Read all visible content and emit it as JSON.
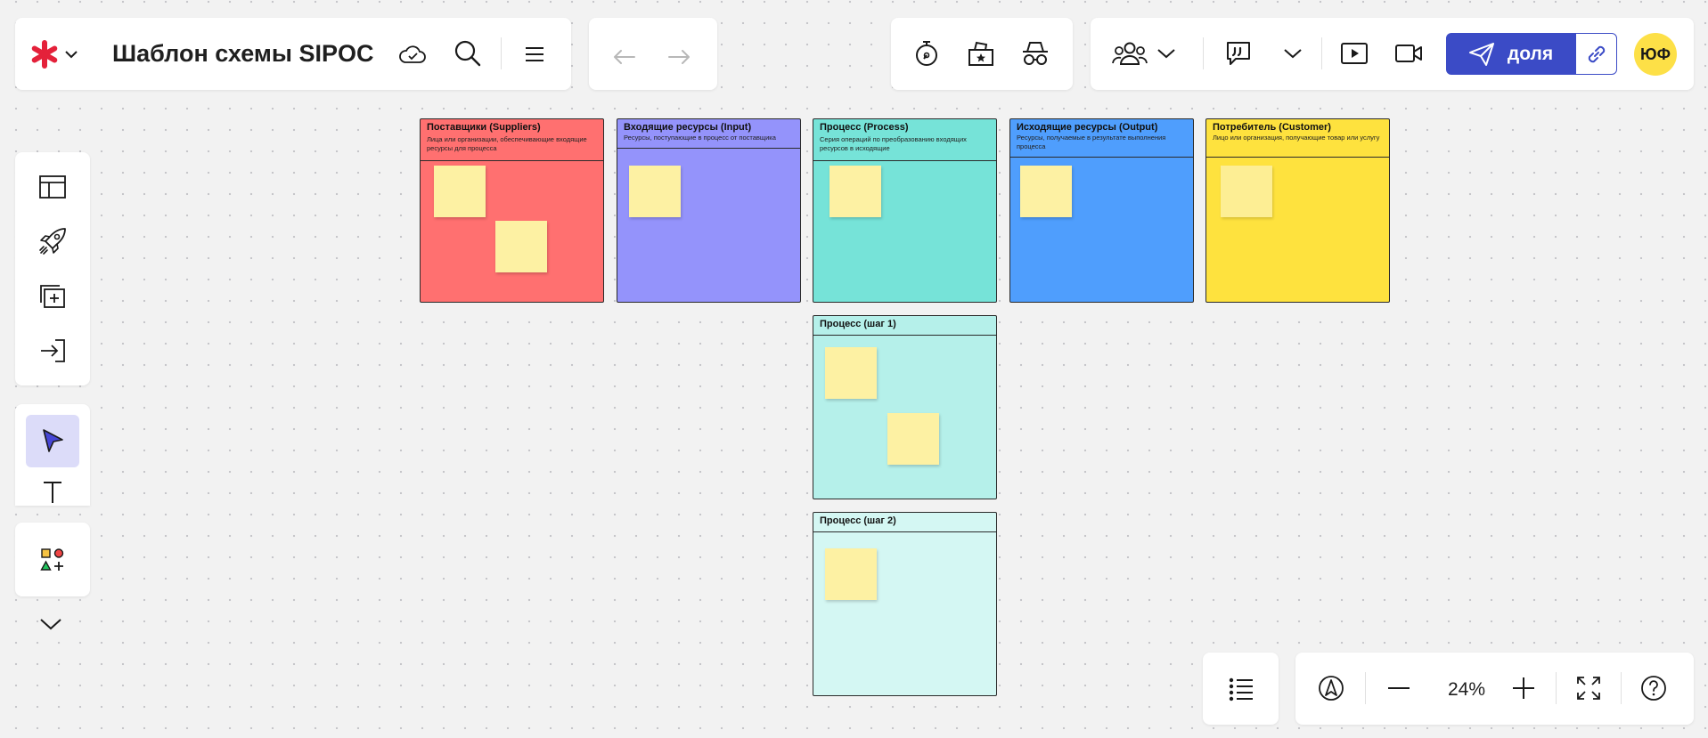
{
  "board": {
    "title": "Шаблон схемы SIPOC",
    "zoom": "24%"
  },
  "toolbar": {
    "share_label": "доля",
    "avatar_initials": "ЮФ"
  },
  "colors": {
    "suppliers": "#ff7070",
    "input": "#9493fb",
    "process": "#76e3d8",
    "output": "#4f9efd",
    "customer": "#fee23e",
    "step1": "#b5f0ea",
    "step2": "#d4f7f3",
    "sticky": "#fdf1a3",
    "accent": "#3b4bc6"
  },
  "columns": [
    {
      "title": "Поставщики (Suppliers)",
      "desc": "Лица или организации, обеспечивающие входящие ресурсы для процесса"
    },
    {
      "title": "Входящие ресурсы (Input)",
      "desc": "Ресурсы, поступающие в процесс от поставщика"
    },
    {
      "title": "Процесс (Process)",
      "desc": "Серия операций по преобразованию входящих ресурсов в исходящие"
    },
    {
      "title": "Исходящие ресурсы (Output)",
      "desc": "Ресурсы, получаемые в результате выполнения процесса"
    },
    {
      "title": "Потребитель (Customer)",
      "desc": "Лицо или организация, получающие товар или услугу"
    }
  ],
  "steps": [
    {
      "title": "Процесс (шаг 1)"
    },
    {
      "title": "Процесс (шаг 2)"
    }
  ]
}
